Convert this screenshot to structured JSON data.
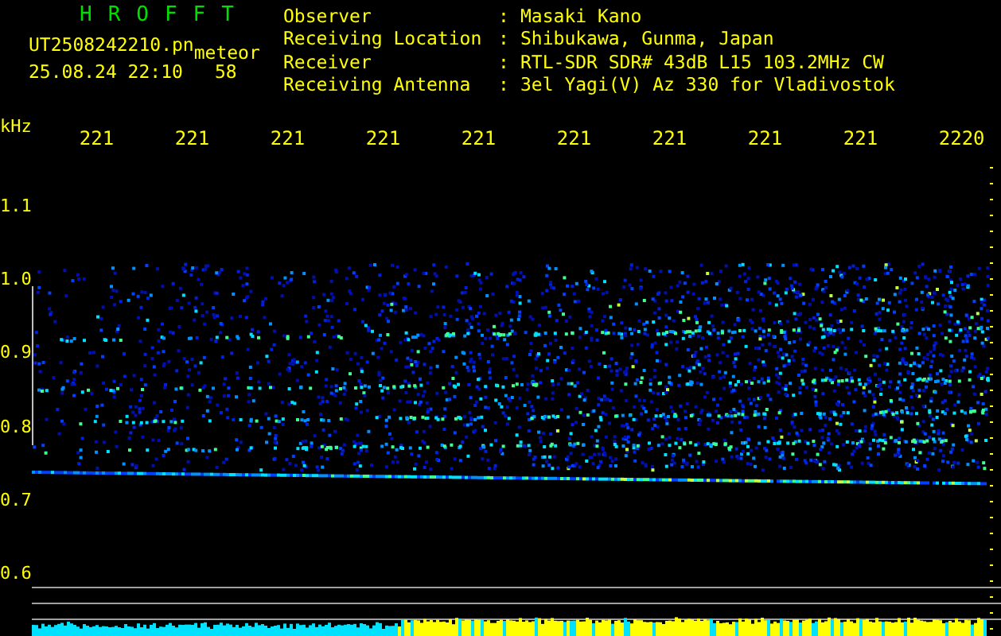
{
  "title": "HROFFT",
  "file": "UT2508242210.pn",
  "mode": "meteor",
  "datetime": "25.08.24 22:10",
  "count": "58",
  "info": [
    {
      "label": "Observer",
      "sep": ":",
      "value": "Masaki Kano"
    },
    {
      "label": "Receiving Location",
      "sep": ":",
      "value": "Shibukawa, Gunma, Japan"
    },
    {
      "label": "Receiver",
      "sep": ":",
      "value": "RTL-SDR SDR# 43dB L15 103.2MHz CW"
    },
    {
      "label": "Receiving Antenna",
      "sep": ":",
      "value": "3el Yagi(V) Az 330 for Vladivostok"
    }
  ],
  "y_unit": "kHz",
  "x_labels": [
    "221",
    "221",
    "221",
    "221",
    "221",
    "221",
    "221",
    "221",
    "221",
    "2220"
  ],
  "y_labels": [
    "1.1",
    "1.0",
    "0.9",
    "0.8",
    "0.7",
    "0.6"
  ]
}
